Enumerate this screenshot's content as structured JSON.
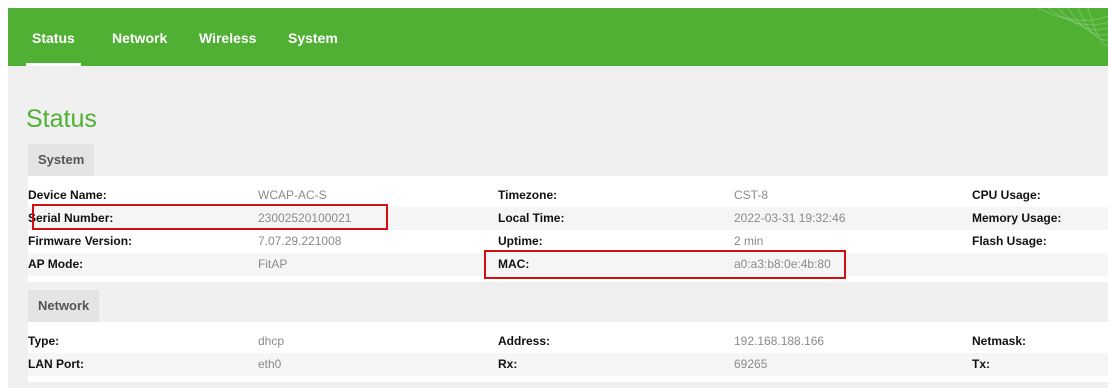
{
  "nav": {
    "items": [
      {
        "label": "Status"
      },
      {
        "label": "Network"
      },
      {
        "label": "Wireless"
      },
      {
        "label": "System"
      }
    ]
  },
  "page_title": "Status",
  "system": {
    "tab_label": "System",
    "rows": [
      {
        "c1_label": "Device Name:",
        "c1_value": "WCAP-AC-S",
        "c2_label": "Timezone:",
        "c2_value": "CST-8",
        "c3_label": "CPU Usage:"
      },
      {
        "c1_label": "Serial Number:",
        "c1_value": "23002520100021",
        "c2_label": "Local Time:",
        "c2_value": "2022-03-31 19:32:46",
        "c3_label": "Memory Usage:"
      },
      {
        "c1_label": "Firmware Version:",
        "c1_value": "7.07.29.221008",
        "c2_label": "Uptime:",
        "c2_value": "2 min",
        "c3_label": "Flash Usage:"
      },
      {
        "c1_label": "AP Mode:",
        "c1_value": "FitAP",
        "c2_label": "MAC:",
        "c2_value": "a0:a3:b8:0e:4b:80",
        "c3_label": ""
      }
    ]
  },
  "network": {
    "tab_label": "Network",
    "rows": [
      {
        "c1_label": "Type:",
        "c1_value": "dhcp",
        "c2_label": "Address:",
        "c2_value": "192.168.188.166",
        "c3_label": "Netmask:"
      },
      {
        "c1_label": "LAN Port:",
        "c1_value": "eth0",
        "c2_label": "Rx:",
        "c2_value": "69265",
        "c3_label": "Tx:"
      }
    ]
  },
  "colors": {
    "brand_green": "#4fb033",
    "highlight_red": "#d40e0e"
  }
}
